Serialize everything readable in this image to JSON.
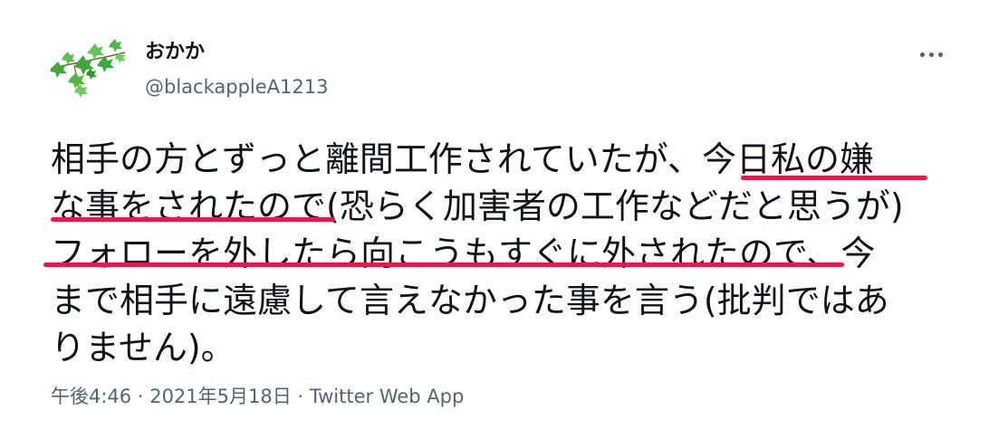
{
  "author": {
    "name": "おかか",
    "handle": "@blackappleA1213",
    "avatar_icon": "ivy-leaves-avatar"
  },
  "more_icon": "more-horizontal-icon",
  "tweet": {
    "lines": [
      [
        "相手の方とずっと離間工作されていたが、",
        "今日私の嫌"
      ],
      [
        "な事をされたので",
        "(恐らく加害者の工作などだと思うが)"
      ],
      [
        "フォローを外したら向こうもすぐに外されたので",
        "、今"
      ],
      [
        "まで相手に遠慮して言えなかった事を言う(批判ではあ"
      ],
      [
        "りません)。"
      ]
    ],
    "underline_color": "#e6194b"
  },
  "meta": {
    "time": "午後4:46",
    "separator": " · ",
    "date": "2021年5月18日",
    "source": "Twitter Web App"
  },
  "colors": {
    "text": "#0f1419",
    "secondary": "#536471",
    "underline": "#e6194b"
  }
}
